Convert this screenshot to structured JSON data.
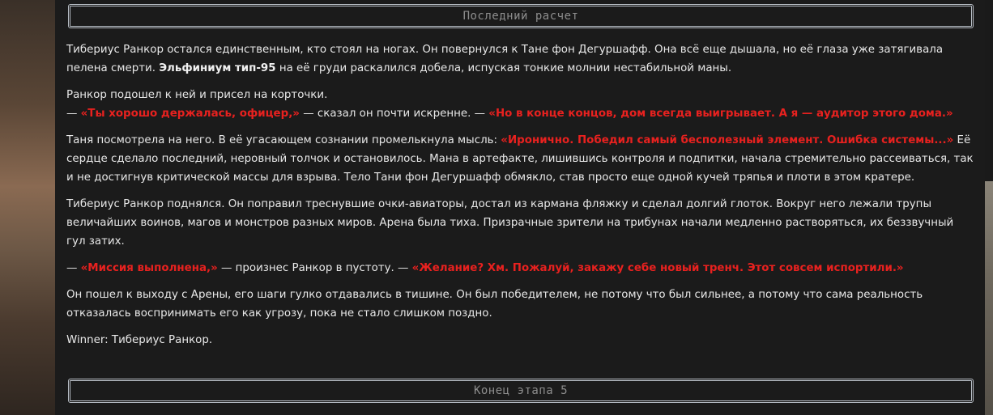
{
  "header": {
    "title": "Последний расчет"
  },
  "story": {
    "p1": {
      "a": "Тибериус Ранкор остался единственным, кто стоял на ногах. Он повернулся к Тане фон Дегуршафф. Она всё еще дышала, но её глаза уже затягивала пелена смерти. ",
      "b": "Эльфиниум тип-95",
      "c": " на её груди раскалился добела, испуская тонкие молнии нестабильной маны."
    },
    "p2": {
      "line1": "Ранкор подошел к ней и присел на корточки.",
      "a": "— ",
      "b": "«Ты хорошо держалась, офицер,»",
      "c": " — сказал он почти искренне. — ",
      "d": "«Но в конце концов, дом всегда выигрывает. А я — аудитор этого дома.»"
    },
    "p3": {
      "a": "Таня посмотрела на него. В её угасающем сознании промелькнула мысль: ",
      "b": "«Иронично. Победил самый бесполезный элемент. Ошибка системы...»",
      "c": " Её сердце сделало последний, неровный толчок и остановилось. Мана в артефакте, лишившись контроля и подпитки, начала стремительно рассеиваться, так и не достигнув критической массы для взрыва. Тело Тани фон Дегуршафф обмякло, став просто еще одной кучей тряпья и плоти в этом кратере."
    },
    "p4": "Тибериус Ранкор поднялся. Он поправил треснувшие очки-авиаторы, достал из кармана фляжку и сделал долгий глоток. Вокруг него лежали трупы величайших воинов, магов и монстров разных миров. Арена была тиха. Призрачные зрители на трибунах начали медленно растворяться, их беззвучный гул затих.",
    "p5": {
      "a": "— ",
      "b": "«Миссия выполнена,»",
      "c": " — произнес Ранкор в пустоту. — ",
      "d": "«Желание? Хм. Пожалуй, закажу себе новый тренч. Этот совсем испортили.»"
    },
    "p6": "Он пошел к выходу с Арены, его шаги гулко отдавались в тишине. Он был победителем, не потому что был сильнее, а потому что сама реальность отказалась воспринимать его как угрозу, пока не стало слишком поздно.",
    "p7": "Winner: Тибериус Ранкор."
  },
  "footer": {
    "title": "Конец этапа 5"
  },
  "colors": {
    "accent_red": "#e8211f",
    "text": "#e8e8e8",
    "panel_bg": "#1b1b1b",
    "border": "#b9bfc7"
  }
}
